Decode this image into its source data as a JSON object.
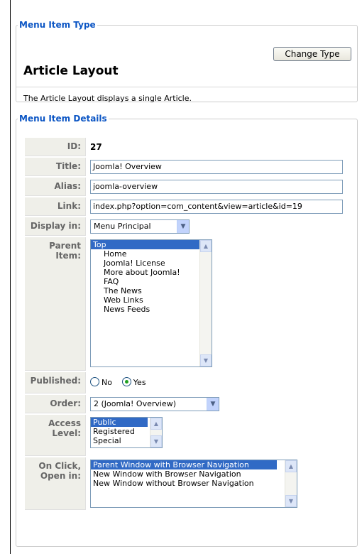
{
  "menu_item_type": {
    "legend": "Menu Item Type",
    "change_button": "Change Type",
    "layout_title": "Article Layout",
    "layout_description": "The Article Layout displays a single Article."
  },
  "menu_item_details": {
    "legend": "Menu Item Details",
    "id": {
      "label": "ID:",
      "value": "27"
    },
    "title": {
      "label": "Title:",
      "value": "Joomla! Overview"
    },
    "alias": {
      "label": "Alias:",
      "value": "joomla-overview"
    },
    "link": {
      "label": "Link:",
      "value": "index.php?option=com_content&view=article&id=19"
    },
    "display_in": {
      "label": "Display in:",
      "selected": "Menu Principal"
    },
    "parent_item": {
      "label_line1": "Parent",
      "label_line2": "Item:",
      "options": [
        "Top",
        "Home",
        "Joomla! License",
        "More about Joomla!",
        "FAQ",
        "The News",
        "Web Links",
        "News Feeds"
      ],
      "selected": "Top"
    },
    "published": {
      "label": "Published:",
      "no_label": "No",
      "yes_label": "Yes",
      "value": "Yes"
    },
    "order": {
      "label": "Order:",
      "selected": "2 (Joomla! Overview)"
    },
    "access_level": {
      "label_line1": "Access",
      "label_line2": "Level:",
      "options": [
        "Public",
        "Registered",
        "Special"
      ],
      "selected": "Public"
    },
    "on_click": {
      "label_line1": "On Click,",
      "label_line2": "Open in:",
      "options": [
        "Parent Window with Browser Navigation",
        "New Window with Browser Navigation",
        "New Window without Browser Navigation"
      ],
      "selected": "Parent Window with Browser Navigation"
    }
  },
  "colors": {
    "legend": "#0b55c4",
    "key_bg": "#efefe9",
    "selection": "#316ac5"
  },
  "icons": {
    "dropdown": "chevron-down-icon",
    "scroll_up": "scroll-up-icon",
    "scroll_down": "scroll-down-icon"
  }
}
